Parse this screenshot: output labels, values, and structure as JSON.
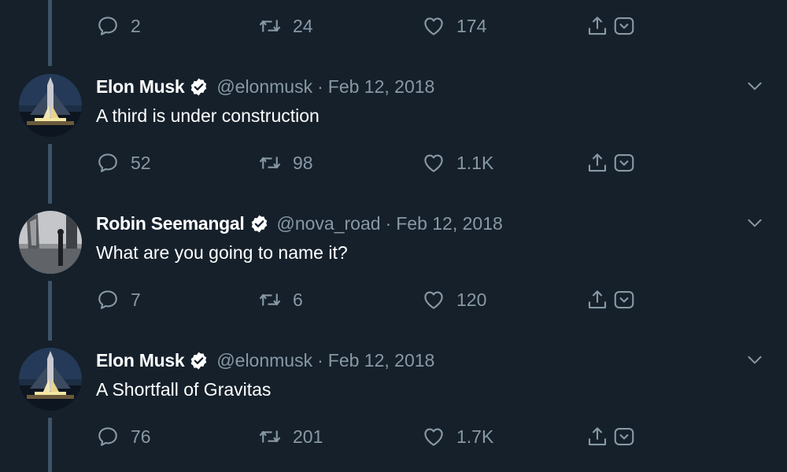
{
  "top_actions": {
    "replies": "2",
    "retweets": "24",
    "likes": "174"
  },
  "tweets": [
    {
      "name": "Elon Musk",
      "handle": "@elonmusk",
      "sep": "·",
      "date": "Feb 12, 2018",
      "text": "A third is under construction",
      "replies": "52",
      "retweets": "98",
      "likes": "1.1K"
    },
    {
      "name": "Robin Seemangal",
      "handle": "@nova_road",
      "sep": "·",
      "date": "Feb 12, 2018",
      "text": "What are you going to name it?",
      "replies": "7",
      "retweets": "6",
      "likes": "120"
    },
    {
      "name": "Elon Musk",
      "handle": "@elonmusk",
      "sep": "·",
      "date": "Feb 12, 2018",
      "text": "A Shortfall of Gravitas",
      "replies": "76",
      "retweets": "201",
      "likes": "1.7K"
    }
  ],
  "colors": {
    "background": "#15202b",
    "muted": "#8899a6",
    "thread_line": "#3d5466",
    "text": "#ffffff"
  },
  "icons": [
    "reply-icon",
    "retweet-icon",
    "like-icon",
    "share-icon",
    "bookmark-icon",
    "verified-icon",
    "chevron-down-icon"
  ]
}
